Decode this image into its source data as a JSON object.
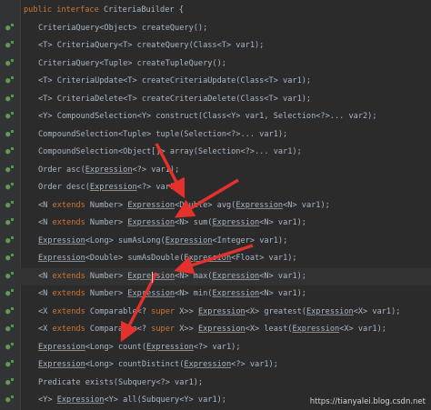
{
  "editor": {
    "lines": [
      {
        "text": "public interface CriteriaBuilder {",
        "segments": [
          {
            "t": "public interface ",
            "c": "kw"
          },
          {
            "t": "CriteriaBuilder {",
            "c": ""
          }
        ],
        "indent": false
      },
      {
        "segments": [
          {
            "t": "CriteriaQuery<Object> createQuery();",
            "c": ""
          }
        ],
        "indent": true
      },
      {
        "segments": [
          {
            "t": "<T> CriteriaQuery<T> createQuery(Class<T> var1);",
            "c": ""
          }
        ],
        "indent": true
      },
      {
        "segments": [
          {
            "t": "CriteriaQuery<Tuple> createTupleQuery();",
            "c": ""
          }
        ],
        "indent": true
      },
      {
        "segments": [
          {
            "t": "<T> CriteriaUpdate<T> createCriteriaUpdate(Class<T> var1);",
            "c": ""
          }
        ],
        "indent": true
      },
      {
        "segments": [
          {
            "t": "<T> CriteriaDelete<T> createCriteriaDelete(Class<T> var1);",
            "c": ""
          }
        ],
        "indent": true
      },
      {
        "segments": [
          {
            "t": "<Y> CompoundSelection<Y> construct(Class<Y> var1, Selection<?>... var2);",
            "c": ""
          }
        ],
        "indent": true
      },
      {
        "segments": [
          {
            "t": "CompoundSelection<Tuple> tuple(Selection<?>... var1);",
            "c": ""
          }
        ],
        "indent": true
      },
      {
        "segments": [
          {
            "t": "CompoundSelection<Object[]> array(Selection<?>... var1);",
            "c": ""
          }
        ],
        "indent": true
      },
      {
        "segments": [
          {
            "t": "Order asc(",
            "c": ""
          },
          {
            "t": "Expression",
            "c": "ul"
          },
          {
            "t": "<?> var1);",
            "c": ""
          }
        ],
        "indent": true
      },
      {
        "segments": [
          {
            "t": "Order desc(",
            "c": ""
          },
          {
            "t": "Expression",
            "c": "ul"
          },
          {
            "t": "<?> var1);",
            "c": ""
          }
        ],
        "indent": true
      },
      {
        "segments": [
          {
            "t": "<N ",
            "c": ""
          },
          {
            "t": "extends",
            "c": "kw"
          },
          {
            "t": " Number> ",
            "c": ""
          },
          {
            "t": "Expression",
            "c": "ul"
          },
          {
            "t": "<Double> avg(",
            "c": ""
          },
          {
            "t": "Expression",
            "c": "ul"
          },
          {
            "t": "<N> var1);",
            "c": ""
          }
        ],
        "indent": true
      },
      {
        "segments": [
          {
            "t": "<N ",
            "c": ""
          },
          {
            "t": "extends",
            "c": "kw"
          },
          {
            "t": " Number> ",
            "c": ""
          },
          {
            "t": "Expression",
            "c": "ul"
          },
          {
            "t": "<N> sum(",
            "c": ""
          },
          {
            "t": "Expression",
            "c": "ul"
          },
          {
            "t": "<N> var1);",
            "c": ""
          }
        ],
        "indent": true
      },
      {
        "segments": [
          {
            "t": "Expression",
            "c": "ul"
          },
          {
            "t": "<Long> sumAsLong(",
            "c": ""
          },
          {
            "t": "Expression",
            "c": "ul"
          },
          {
            "t": "<Integer> var1);",
            "c": ""
          }
        ],
        "indent": true
      },
      {
        "segments": [
          {
            "t": "Expression",
            "c": "ul"
          },
          {
            "t": "<Double> sumAsDouble(",
            "c": ""
          },
          {
            "t": "Expression",
            "c": "ul"
          },
          {
            "t": "<Float> var1);",
            "c": ""
          }
        ],
        "indent": true
      },
      {
        "segments": [
          {
            "t": "<N ",
            "c": ""
          },
          {
            "t": "extends",
            "c": "kw"
          },
          {
            "t": " Number> ",
            "c": ""
          },
          {
            "t": "Expression",
            "c": "ul"
          },
          {
            "t": "<N> max(",
            "c": ""
          },
          {
            "t": "Expression",
            "c": "ul"
          },
          {
            "t": "<N> var1);",
            "c": ""
          }
        ],
        "indent": true,
        "highlight": true
      },
      {
        "segments": [
          {
            "t": "<N ",
            "c": ""
          },
          {
            "t": "extends",
            "c": "kw"
          },
          {
            "t": " Number> ",
            "c": ""
          },
          {
            "t": "Expression",
            "c": "ul"
          },
          {
            "t": "<N> min(",
            "c": ""
          },
          {
            "t": "Expression",
            "c": "ul"
          },
          {
            "t": "<N> var1);",
            "c": ""
          }
        ],
        "indent": true
      },
      {
        "segments": [
          {
            "t": "<X ",
            "c": ""
          },
          {
            "t": "extends",
            "c": "kw"
          },
          {
            "t": " Comparable<? ",
            "c": ""
          },
          {
            "t": "super",
            "c": "kw"
          },
          {
            "t": " X>> ",
            "c": ""
          },
          {
            "t": "Expression",
            "c": "ul"
          },
          {
            "t": "<X> greatest(",
            "c": ""
          },
          {
            "t": "Expression",
            "c": "ul"
          },
          {
            "t": "<X> var1);",
            "c": ""
          }
        ],
        "indent": true
      },
      {
        "segments": [
          {
            "t": "<X ",
            "c": ""
          },
          {
            "t": "extends",
            "c": "kw"
          },
          {
            "t": " Comparable<? ",
            "c": ""
          },
          {
            "t": "super",
            "c": "kw"
          },
          {
            "t": " X>> ",
            "c": ""
          },
          {
            "t": "Expression",
            "c": "ul"
          },
          {
            "t": "<X> least(",
            "c": ""
          },
          {
            "t": "Expression",
            "c": "ul"
          },
          {
            "t": "<X> var1);",
            "c": ""
          }
        ],
        "indent": true
      },
      {
        "segments": [
          {
            "t": "Expression",
            "c": "ul"
          },
          {
            "t": "<Long> count(",
            "c": ""
          },
          {
            "t": "Expression",
            "c": "ul"
          },
          {
            "t": "<?> var1);",
            "c": ""
          }
        ],
        "indent": true
      },
      {
        "segments": [
          {
            "t": "Expression",
            "c": "ul"
          },
          {
            "t": "<Long> countDistinct(",
            "c": ""
          },
          {
            "t": "Expression",
            "c": "ul"
          },
          {
            "t": "<?> var1);",
            "c": ""
          }
        ],
        "indent": true
      },
      {
        "segments": [
          {
            "t": "Predicate exists(Subquery<?> var1);",
            "c": ""
          }
        ],
        "indent": true
      },
      {
        "segments": [
          {
            "t": "<Y> ",
            "c": ""
          },
          {
            "t": "Expression",
            "c": "ul"
          },
          {
            "t": "<Y> all(Subquery<Y> var1);",
            "c": ""
          }
        ],
        "indent": true
      }
    ]
  },
  "gutter_icon": "implemented-method-icon",
  "annotation_color": "#e4312b",
  "watermark": "https://tianyalei.blog.csdn.net"
}
